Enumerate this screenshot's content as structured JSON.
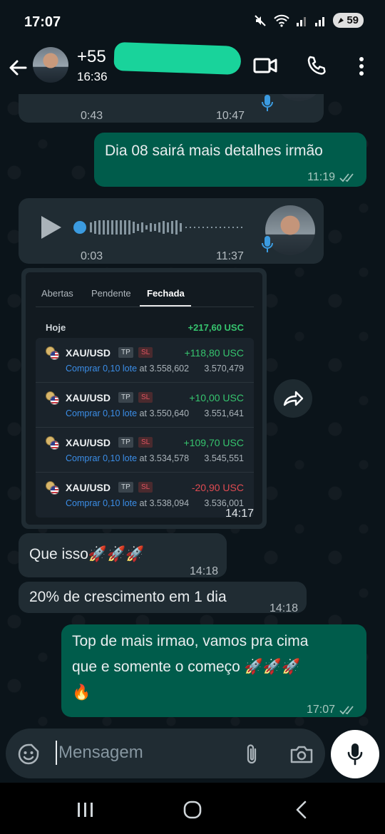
{
  "status_bar": {
    "time": "17:07",
    "battery": "59"
  },
  "header": {
    "contact_name": "+55",
    "contact_status": "16:36"
  },
  "messages": {
    "voice_partial": {
      "position_time": "0:43",
      "sent_time": "10:47"
    },
    "out_1": {
      "text": "Dia 08 sairá mais detalhes irmão",
      "time": "11:19"
    },
    "voice_1": {
      "duration": "0:03",
      "time": "11:37"
    },
    "screenshot": {
      "tabs": [
        "Abertas",
        "Pendente",
        "Fechada"
      ],
      "active_tab": "Fechada",
      "today_label": "Hoje",
      "today_total": "+217,60 USC",
      "trades": [
        {
          "symbol": "XAU/USD",
          "tp": "TP",
          "sl": "SL",
          "pnl": "+118,80 USC",
          "action": "Comprar 0,10 lote",
          "open": "at 3.558,602",
          "close": "3.570,479",
          "positive": true
        },
        {
          "symbol": "XAU/USD",
          "tp": "TP",
          "sl": "SL",
          "pnl": "+10,00 USC",
          "action": "Comprar 0,10 lote",
          "open": "at 3.550,640",
          "close": "3.551,641",
          "positive": true
        },
        {
          "symbol": "XAU/USD",
          "tp": "TP",
          "sl": "SL",
          "pnl": "+109,70 USC",
          "action": "Comprar 0,10 lote",
          "open": "at 3.534,578",
          "close": "3.545,551",
          "positive": true
        },
        {
          "symbol": "XAU/USD",
          "tp": "TP",
          "sl": "SL",
          "pnl": "-20,90 USC",
          "action": "Comprar 0,10 lote",
          "open": "at 3.538,094",
          "close": "3.536,001",
          "positive": false
        }
      ],
      "time": "14:17"
    },
    "in_1": {
      "text": "Que isso",
      "emoji": "🚀🚀🚀",
      "time": "14:18"
    },
    "in_2": {
      "text": "20% de crescimento em 1 dia",
      "time": "14:18"
    },
    "out_2": {
      "line1": "Top de mais irmao, vamos pra cima",
      "line2": "que e somente o começo 🚀🚀🚀",
      "line3": "🔥",
      "time": "17:07"
    }
  },
  "input": {
    "placeholder": "Mensagem"
  },
  "colors": {
    "incoming": "#202c33",
    "outgoing": "#005c4b",
    "positive": "#36c46e",
    "negative": "#e04b52",
    "buy_link": "#3b8ee8"
  }
}
